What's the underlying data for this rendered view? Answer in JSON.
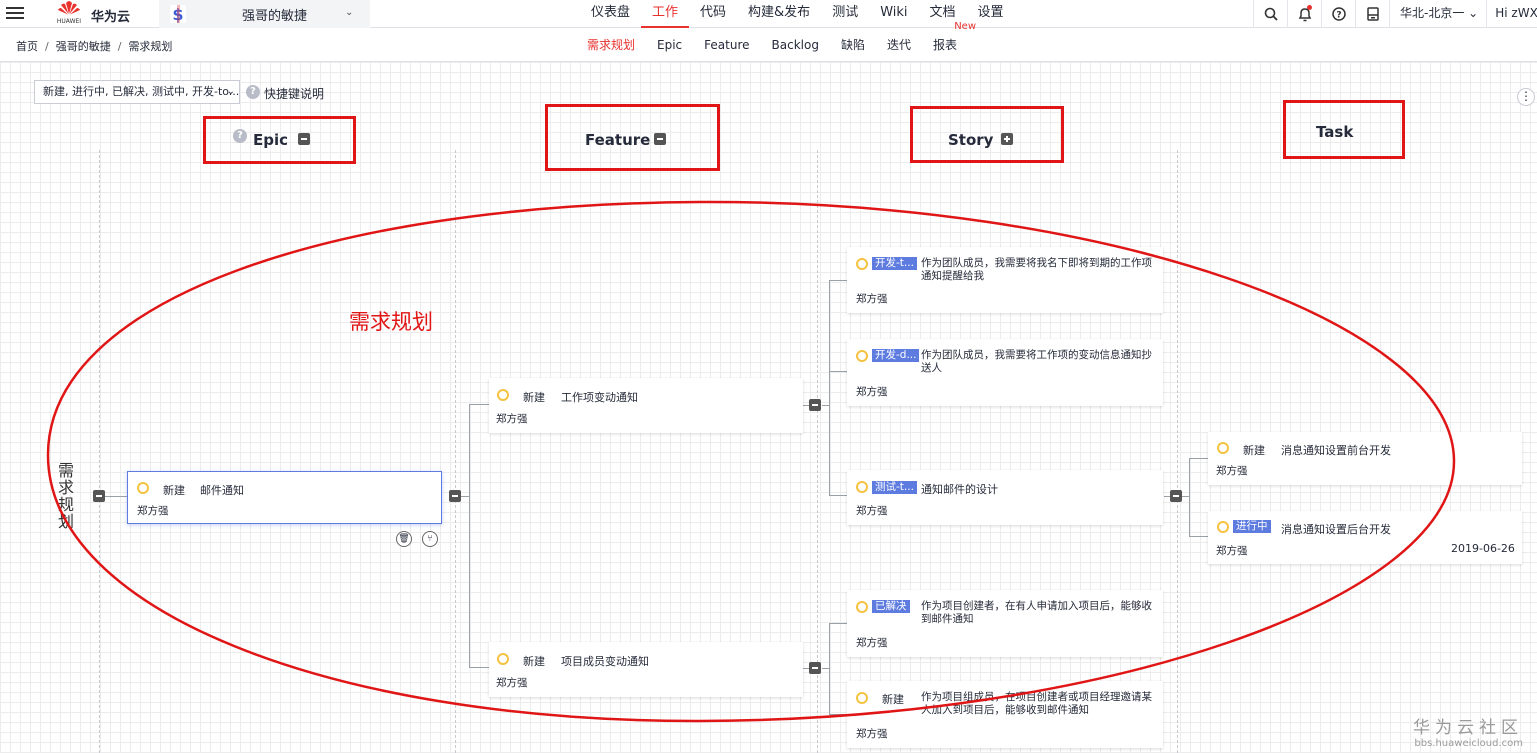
{
  "header": {
    "brand": "华为云",
    "logo_text": "HUAWEI",
    "project_name": "强哥的敏捷",
    "nav": [
      "仪表盘",
      "工作",
      "代码",
      "构建&发布",
      "测试",
      "Wiki",
      "文档",
      "设置"
    ],
    "active_nav": "工作",
    "region": "华北-北京一",
    "user": "Hi zWX"
  },
  "subheader": {
    "breadcrumb": [
      "首页",
      "强哥的敏捷",
      "需求规划"
    ],
    "tabs": [
      "需求规划",
      "Epic",
      "Feature",
      "Backlog",
      "缺陷",
      "迭代",
      "报表"
    ],
    "active_tab": "需求规划",
    "new_badge": "New"
  },
  "toolbar": {
    "filter_value": "新建, 进行中, 已解决, 测试中, 开发-to...",
    "shortcut_label": "快捷键说明",
    "help_glyph": "?",
    "more_glyph": "⋮"
  },
  "columns": {
    "epic": "Epic",
    "feature": "Feature",
    "story": "Story",
    "task": "Task"
  },
  "row_label": "需求规划",
  "annotation": "需求规划",
  "epic": {
    "status": "新建",
    "title": "邮件通知",
    "owner": "郑方强"
  },
  "features": [
    {
      "status": "新建",
      "title": "工作项变动通知",
      "owner": "郑方强"
    },
    {
      "status": "新建",
      "title": "项目成员变动通知",
      "owner": "郑方强"
    }
  ],
  "stories": [
    {
      "status": "开发-t...",
      "title": "作为团队成员，我需要将我名下即将到期的工作项通知提醒给我",
      "owner": "郑方强"
    },
    {
      "status": "开发-d...",
      "title": "作为团队成员，我需要将工作项的变动信息通知抄送人",
      "owner": "郑方强"
    },
    {
      "status": "测试-t...",
      "title": "通知邮件的设计",
      "owner": "郑方强"
    },
    {
      "status": "已解决",
      "title": "作为项目创建者，在有人申请加入项目后，能够收到邮件通知",
      "owner": "郑方强"
    },
    {
      "status": "新建",
      "title": "作为项目组成员，在项目创建者或项目经理邀请某人加入到项目后，能够收到邮件通知",
      "owner": "郑方强"
    }
  ],
  "tasks": [
    {
      "status": "新建",
      "title": "消息通知设置前台开发",
      "owner": "郑方强",
      "date": ""
    },
    {
      "status": "进行中",
      "title": "消息通知设置后台开发",
      "owner": "郑方强",
      "date": "2019-06-26"
    }
  ],
  "watermark": {
    "main": "华为云社区",
    "sub": "bbs.huaweicloud.com"
  },
  "colors": {
    "accent_red": "#e8322e",
    "annotation_red": "#e01616",
    "tag_blue": "#5e7ce0",
    "ring_yellow": "#f5c242"
  }
}
